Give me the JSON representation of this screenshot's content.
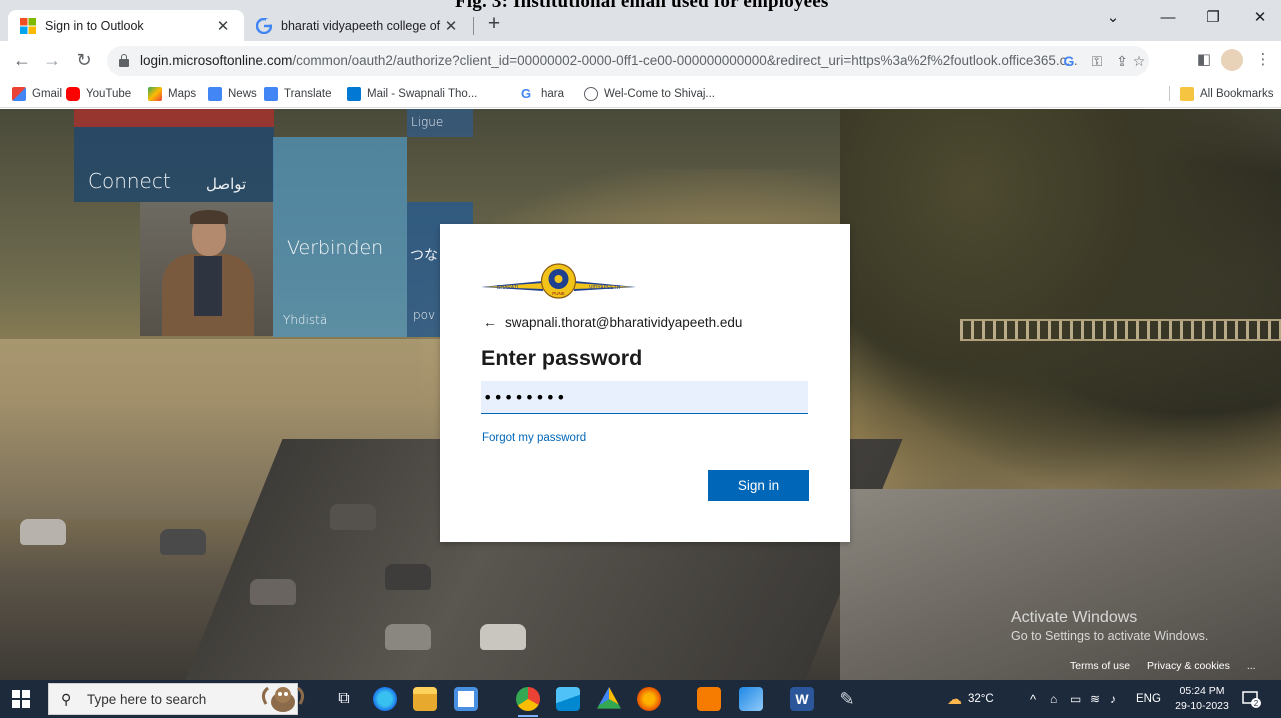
{
  "overlay_text": "Fig. 3: Institutional email used for employees",
  "browser": {
    "tabs": [
      {
        "title": "Sign in to Outlook",
        "active": true,
        "favicon": "microsoft-logo-icon"
      },
      {
        "title": "bharati vidyapeeth college of ph",
        "active": false,
        "favicon": "google-g-icon"
      }
    ],
    "url_host": "login.microsoftonline.com",
    "url_path": "/common/oauth2/authorize?client_id=00000002-0000-0ff1-ce00-000000000000&redirect_uri=https%3a%2f%2foutlook.office365.c...",
    "bookmarks": [
      {
        "label": "Gmail",
        "icon": "gmail-icon",
        "color": "#ea4335"
      },
      {
        "label": "YouTube",
        "icon": "youtube-icon",
        "color": "#ff0000"
      },
      {
        "label": "Maps",
        "icon": "maps-icon",
        "color": "#34a853"
      },
      {
        "label": "News",
        "icon": "news-icon",
        "color": "#4285f4"
      },
      {
        "label": "Translate",
        "icon": "translate-icon",
        "color": "#4285f4"
      },
      {
        "label": "Mail - Swapnali Tho...",
        "icon": "outlook-icon",
        "color": "#0078d4"
      },
      {
        "label": "hara",
        "icon": "google-g-icon",
        "color": "#4285f4"
      },
      {
        "label": "Wel-Come to Shivaj...",
        "icon": "globe-icon",
        "color": "#5f6368"
      }
    ],
    "all_bookmarks": "All Bookmarks"
  },
  "background_tiles": {
    "connect": "Connect",
    "connect_ar": "تواصل",
    "verbinden": "Verbinden",
    "tsuna": "つな",
    "ligue": "Ligue",
    "yhdista": "Yhdistä",
    "pov": "pov"
  },
  "login": {
    "account": "swapnali.thorat@bharatividyapeeth.edu",
    "heading": "Enter password",
    "password_value": "••••••••",
    "forgot": "Forgot my password",
    "signin": "Sign in",
    "logo_left": "BHARATI",
    "logo_right": "VIDYAPEETH",
    "logo_center": "PUNE"
  },
  "watermark": {
    "line1": "Activate Windows",
    "line2": "Go to Settings to activate Windows."
  },
  "footer": {
    "terms": "Terms of use",
    "privacy": "Privacy & cookies",
    "more": "..."
  },
  "taskbar": {
    "search_placeholder": "Type here to search",
    "weather": "32°C",
    "language": "ENG",
    "time": "05:24 PM",
    "date": "29-10-2023",
    "notification_count": "2"
  },
  "colors": {
    "accent": "#0067b8",
    "taskbar": "#1d2a3c"
  }
}
